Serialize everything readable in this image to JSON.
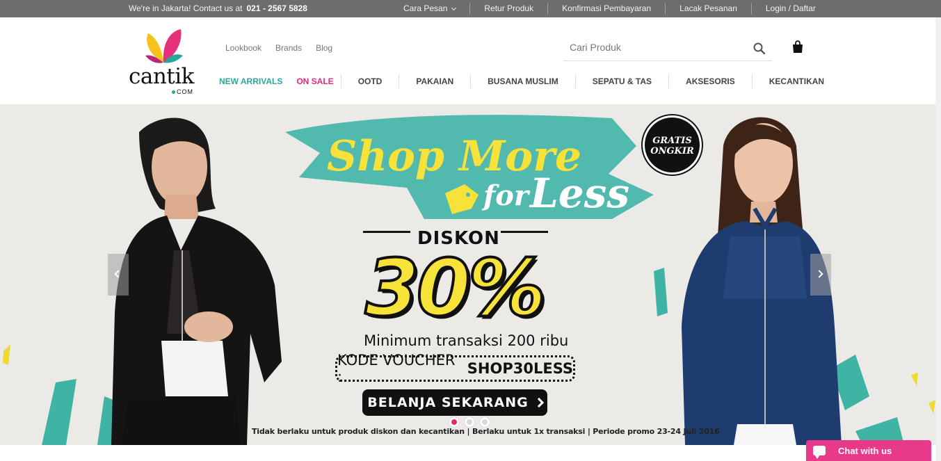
{
  "topbar": {
    "contact_text": "We're in Jakarta! Contact us at",
    "phone": "021 - 2567 5828",
    "links": [
      "Cara Pesan",
      "Retur Produk",
      "Konfirmasi Pembayaran",
      "Lacak Pesanan",
      "Login / Daftar"
    ]
  },
  "brand": {
    "wordmark": "cantik",
    "suffix": "COM"
  },
  "subnav": [
    "Lookbook",
    "Brands",
    "Blog"
  ],
  "search": {
    "placeholder": "Cari Produk",
    "value": ""
  },
  "mainnav": [
    "NEW ARRIVALS",
    "ON SALE",
    "OOTD",
    "PAKAIAN",
    "BUSANA MUSLIM",
    "SEPATU & TAS",
    "AKSESORIS",
    "KECANTIKAN"
  ],
  "hero": {
    "headline_1": "Shop More",
    "headline_2": "for",
    "headline_3": "Less",
    "badge": [
      "GRATIS",
      "ONGKIR"
    ],
    "diskon": "DISKON",
    "percent": "30%",
    "minimum": "Minimum transaksi 200 ribu",
    "voucher_label": "KODE VOUCHER :",
    "voucher_code": "SHOP30LESS",
    "cta": "BELANJA SEKARANG",
    "terms": "Tidak berlaku untuk produk diskon dan kecantikan | Berlaku untuk 1x transaksi | Periode promo 23-24 Juli 2016",
    "slides": 3,
    "active_slide": 1
  },
  "chat": {
    "label": "Chat with us"
  },
  "colors": {
    "accent_teal": "#2ea699",
    "accent_pink": "#e62a7a",
    "topbar": "#6d6d6d",
    "promo_yellow": "#f7e23a"
  }
}
